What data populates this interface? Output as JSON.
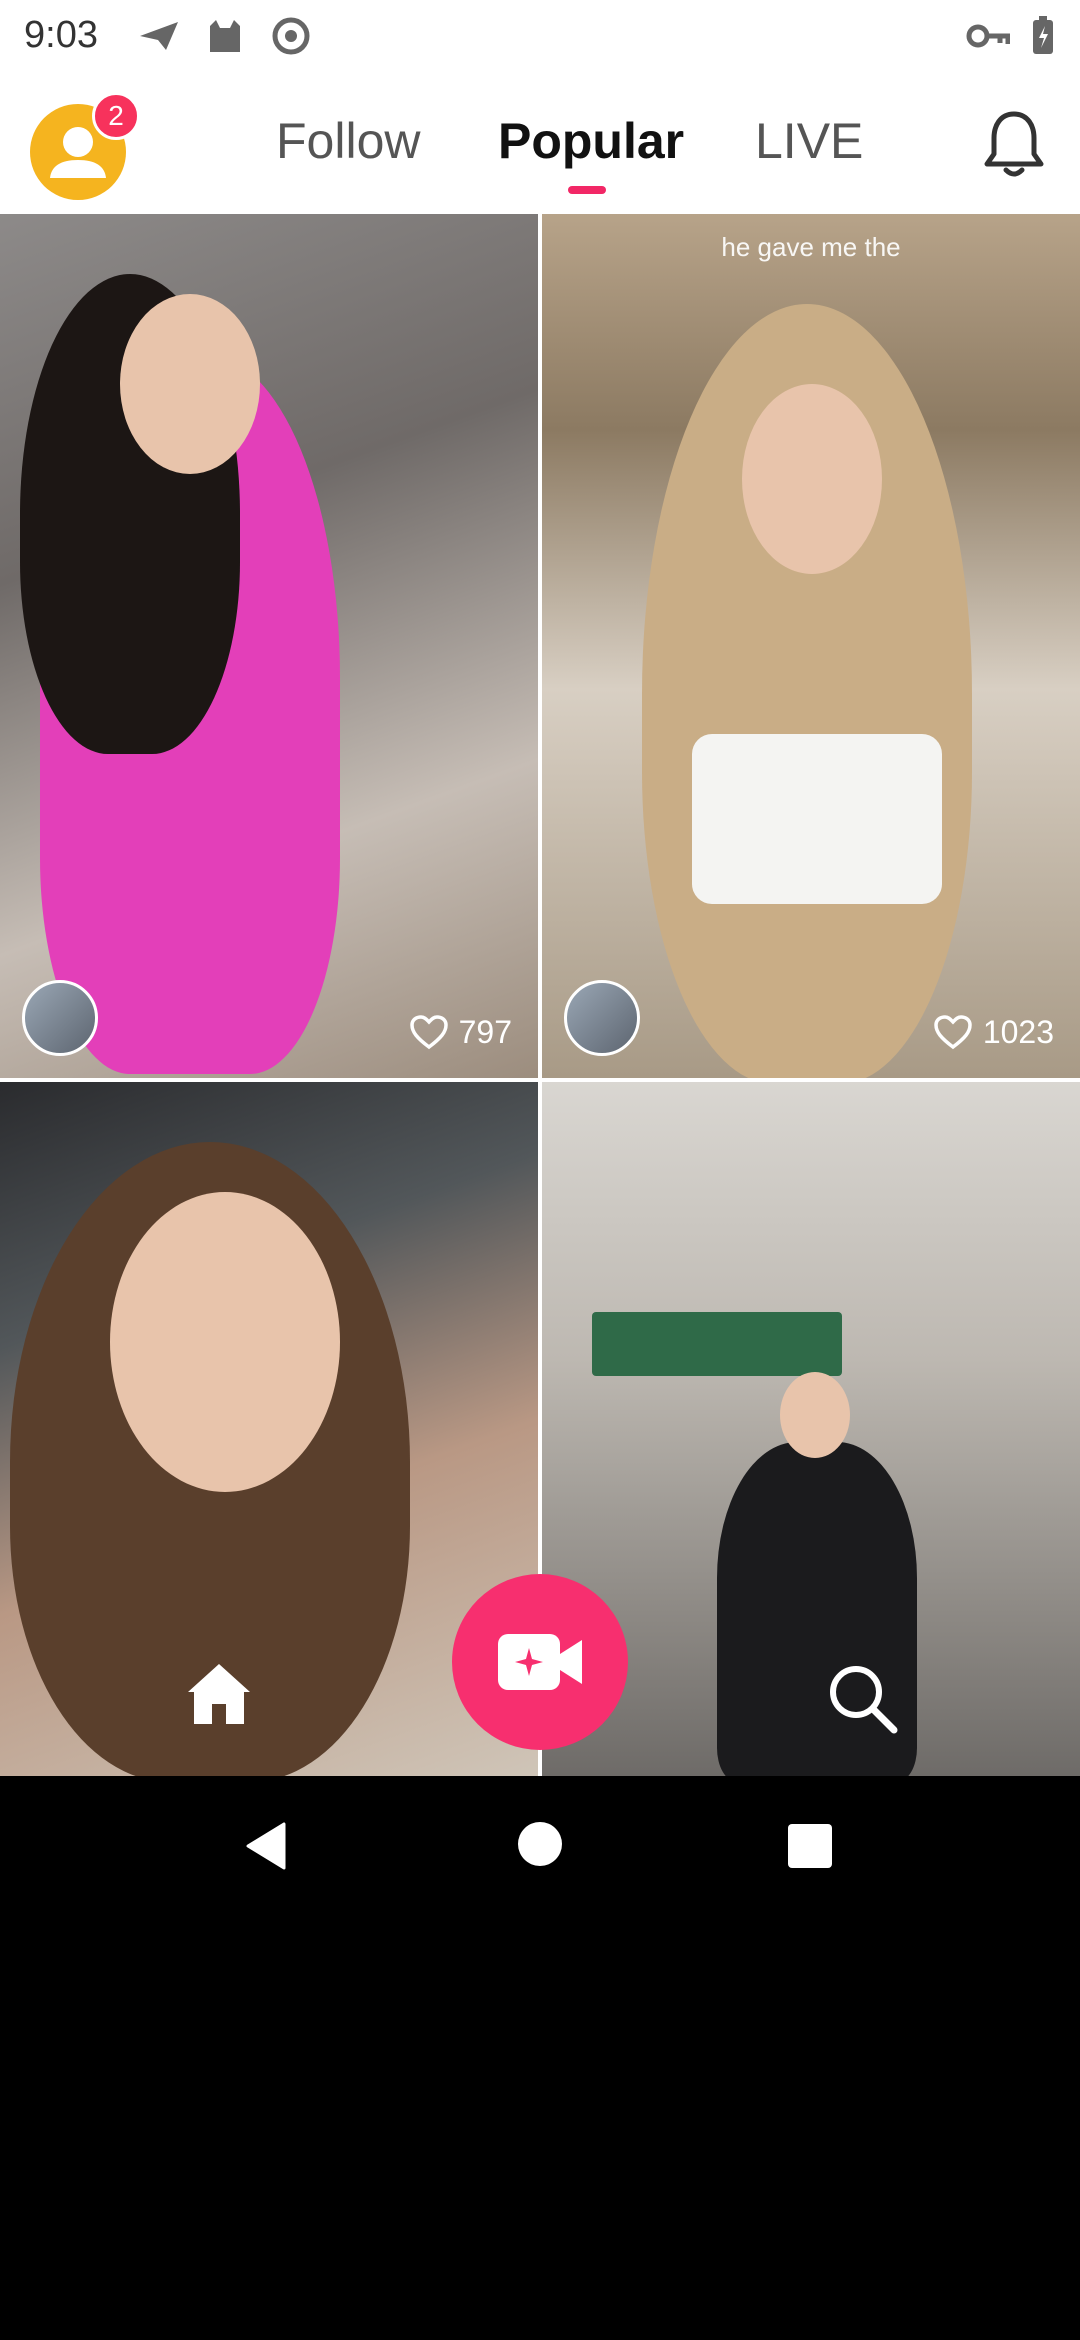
{
  "status_bar": {
    "time": "9:03",
    "icons": [
      "send-icon",
      "cat-icon",
      "at-sign-icon",
      "key-icon",
      "battery-icon"
    ]
  },
  "header": {
    "notification_count": "2",
    "tabs": [
      {
        "label": "Follow",
        "active": false
      },
      {
        "label": "Popular",
        "active": true
      },
      {
        "label": "LIVE",
        "active": false
      }
    ],
    "accent_color": "#f22766"
  },
  "feed": {
    "cards": [
      {
        "caption": "",
        "likes": "797"
      },
      {
        "caption": "he gave me the",
        "likes": "1023"
      },
      {
        "caption": "",
        "likes": ""
      },
      {
        "caption": "",
        "likes": ""
      }
    ]
  },
  "bottom_nav": {
    "items": [
      "home-icon",
      "record-video-icon",
      "search-icon"
    ],
    "record_color": "#f72f6f"
  },
  "system_nav": {
    "items": [
      "back",
      "home",
      "recents"
    ]
  }
}
